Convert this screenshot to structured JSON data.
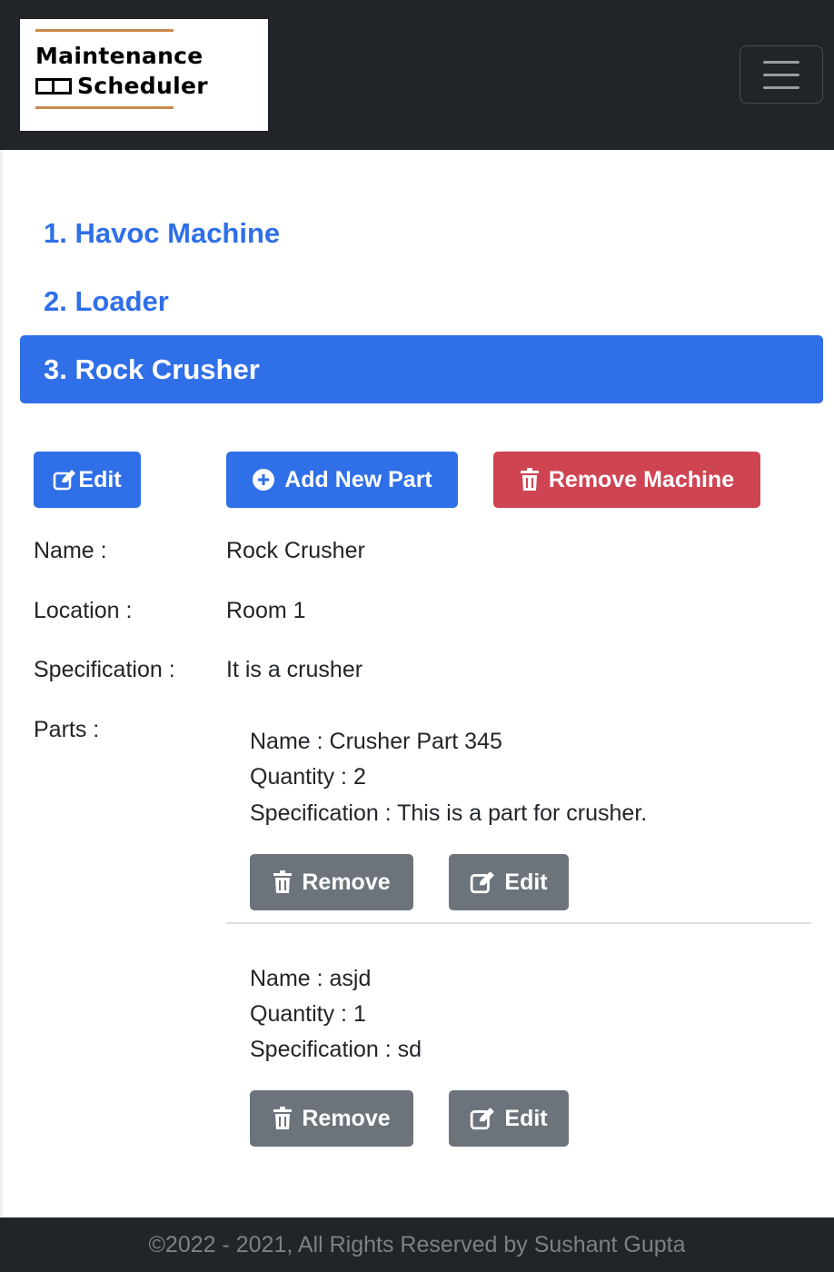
{
  "navbar": {
    "logo": {
      "line1": "Maintenance",
      "line2": "Scheduler"
    },
    "toggle_icon": "hamburger-menu-icon"
  },
  "machines": [
    {
      "label": "1. Havoc Machine",
      "active": false
    },
    {
      "label": "2. Loader",
      "active": false
    },
    {
      "label": "3. Rock Crusher",
      "active": true
    }
  ],
  "actions": {
    "edit_label": "Edit",
    "edit_icon": "edit-icon",
    "add_part_label": "Add New Part",
    "add_part_icon": "plus-circle-icon",
    "remove_machine_label": "Remove Machine",
    "remove_machine_icon": "trash-icon"
  },
  "details": {
    "name_label": "Name :",
    "name_value": "Rock Crusher",
    "location_label": "Location :",
    "location_value": "Room 1",
    "spec_label": "Specification :",
    "spec_value": "It is a crusher",
    "parts_label": "Parts :"
  },
  "parts": [
    {
      "name": "Name : Crusher Part 345",
      "quantity": "Quantity : 2",
      "specification": "Specification : This is a part for crusher.",
      "remove_label": "Remove",
      "edit_label": "Edit"
    },
    {
      "name": "Name : asjd",
      "quantity": "Quantity : 1",
      "specification": "Specification : sd",
      "remove_label": "Remove",
      "edit_label": "Edit"
    }
  ],
  "colors": {
    "primary": "#2f6fe8",
    "danger": "#cf4452",
    "secondary": "#6c737b",
    "dark": "#212529"
  },
  "footer": {
    "text": "©2022 - 2021, All Rights Reserved by Sushant Gupta"
  }
}
